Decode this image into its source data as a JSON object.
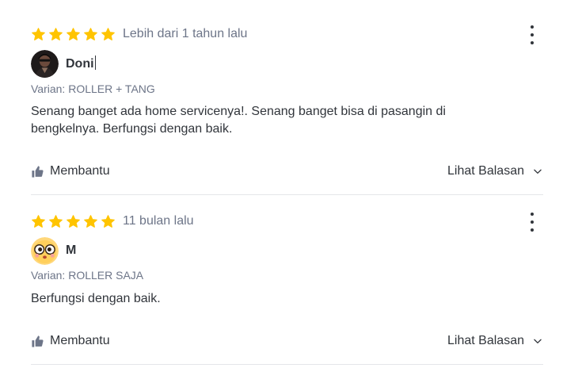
{
  "reviews": [
    {
      "rating": 5,
      "time": "Lebih dari 1 tahun lalu",
      "user": {
        "name": "Doni",
        "avatar_icon": "user-photo-avatar"
      },
      "variant": "Varian: ROLLER + TANG",
      "text": "Senang banget ada home servicenya!. Senang banget bisa di pasangin di bengkelnya. Berfungsi dengan baik.",
      "helpful_label": "Membantu",
      "reply_label": "Lihat Balasan"
    },
    {
      "rating": 5,
      "time": "11 bulan lalu",
      "user": {
        "name": "M",
        "avatar_icon": "cartoon-face-avatar"
      },
      "variant": "Varian: ROLLER SAJA",
      "text": "Berfungsi dengan baik.",
      "helpful_label": "Membantu",
      "reply_label": "Lihat Balasan"
    }
  ],
  "colors": {
    "star": "#ffc400",
    "muted_text": "#6d7588",
    "main_text": "#31353b",
    "divider": "#e4e6e9"
  }
}
